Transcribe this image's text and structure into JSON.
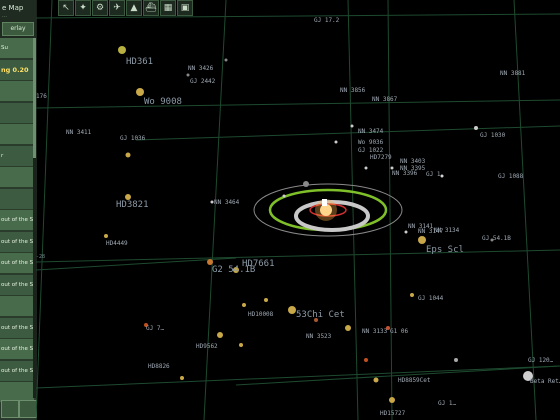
{
  "sidebar": {
    "title": "e Map",
    "subtitle": "…",
    "overlay_button": "erlay",
    "rows": [
      {
        "label": "Su"
      },
      {
        "label": "ng 0.20",
        "highlight": true
      },
      {
        "label": ""
      },
      {
        "label": ""
      },
      {
        "label": ""
      },
      {
        "label": "r"
      },
      {
        "label": ""
      },
      {
        "label": ""
      },
      {
        "label": "out of the Sun"
      },
      {
        "label": "out of the Sun"
      },
      {
        "label": "out of the Sun"
      },
      {
        "label": "out of the Sun"
      },
      {
        "label": ""
      },
      {
        "label": "out of the Sun"
      },
      {
        "label": "out of the Sun"
      },
      {
        "label": "out of the Sun"
      },
      {
        "label": ""
      }
    ]
  },
  "toolbar": {
    "icons": [
      "cursor-icon",
      "satellite-icon",
      "probe-icon",
      "rover-icon",
      "lander-icon",
      "ship-icon",
      "grid-icon",
      "camera-icon"
    ],
    "glyphs": [
      "↖",
      "✦",
      "⚙",
      "✈",
      "▲",
      "⛴",
      "▦",
      "▣"
    ]
  },
  "starmap": {
    "labels": [
      {
        "text": "GJ 17.2",
        "size": "small"
      },
      {
        "text": "HD361",
        "size": "big"
      },
      {
        "text": "NN 3426",
        "size": "small"
      },
      {
        "text": "GJ 2442",
        "size": "small"
      },
      {
        "text": "NN 3881",
        "size": "small"
      },
      {
        "text": "NN 3856",
        "size": "small"
      },
      {
        "text": "NN 3867",
        "size": "small"
      },
      {
        "text": "Wo 9008",
        "size": "big"
      },
      {
        "text": "176",
        "size": "small"
      },
      {
        "text": "NN 3411",
        "size": "small"
      },
      {
        "text": "GJ 1036",
        "size": "small"
      },
      {
        "text": "GJ 1030",
        "size": "small"
      },
      {
        "text": "NN 3474",
        "size": "small"
      },
      {
        "text": "Wo 9036",
        "size": "small"
      },
      {
        "text": "GJ 1022",
        "size": "small"
      },
      {
        "text": "HD7279",
        "size": "small"
      },
      {
        "text": "NN 3403",
        "size": "small"
      },
      {
        "text": "NN 3395",
        "size": "small"
      },
      {
        "text": "NN 3396",
        "size": "small"
      },
      {
        "text": "GJ 1",
        "size": "small"
      },
      {
        "text": "HD3821",
        "size": "big"
      },
      {
        "text": "NN 3464",
        "size": "small"
      },
      {
        "text": "NN 3141",
        "size": "small"
      },
      {
        "text": "NN 3147",
        "size": "small"
      },
      {
        "text": "GJ 54.1B",
        "size": "small"
      },
      {
        "text": "HD4449",
        "size": "small"
      },
      {
        "text": "Eps Scl",
        "size": "big"
      },
      {
        "text": "HD7661",
        "size": "big"
      },
      {
        "text": "G2 54.1B",
        "size": "big"
      },
      {
        "text": "GJ 1044",
        "size": "small"
      },
      {
        "text": "HD10008",
        "size": "small"
      },
      {
        "text": "53Chi Cet",
        "size": "big"
      },
      {
        "text": "GJ 7…",
        "size": "small"
      },
      {
        "text": "NN 3133",
        "size": "small"
      },
      {
        "text": "G1 06",
        "size": "small"
      },
      {
        "text": "HD9562",
        "size": "small"
      },
      {
        "text": "NN 3523",
        "size": "small"
      },
      {
        "text": "GJ 120…",
        "size": "small"
      },
      {
        "text": "HD8826",
        "size": "small"
      },
      {
        "text": "Beta Ret…",
        "size": "small"
      },
      {
        "text": "HD8859Cet",
        "size": "small"
      },
      {
        "text": "GJ 1…",
        "size": "small"
      },
      {
        "text": "HD15727",
        "size": "small"
      },
      {
        "text": "-28",
        "size": "tiny"
      },
      {
        "text": "GJ 1088",
        "size": "small"
      },
      {
        "text": "NN 3134",
        "size": "small"
      }
    ]
  }
}
